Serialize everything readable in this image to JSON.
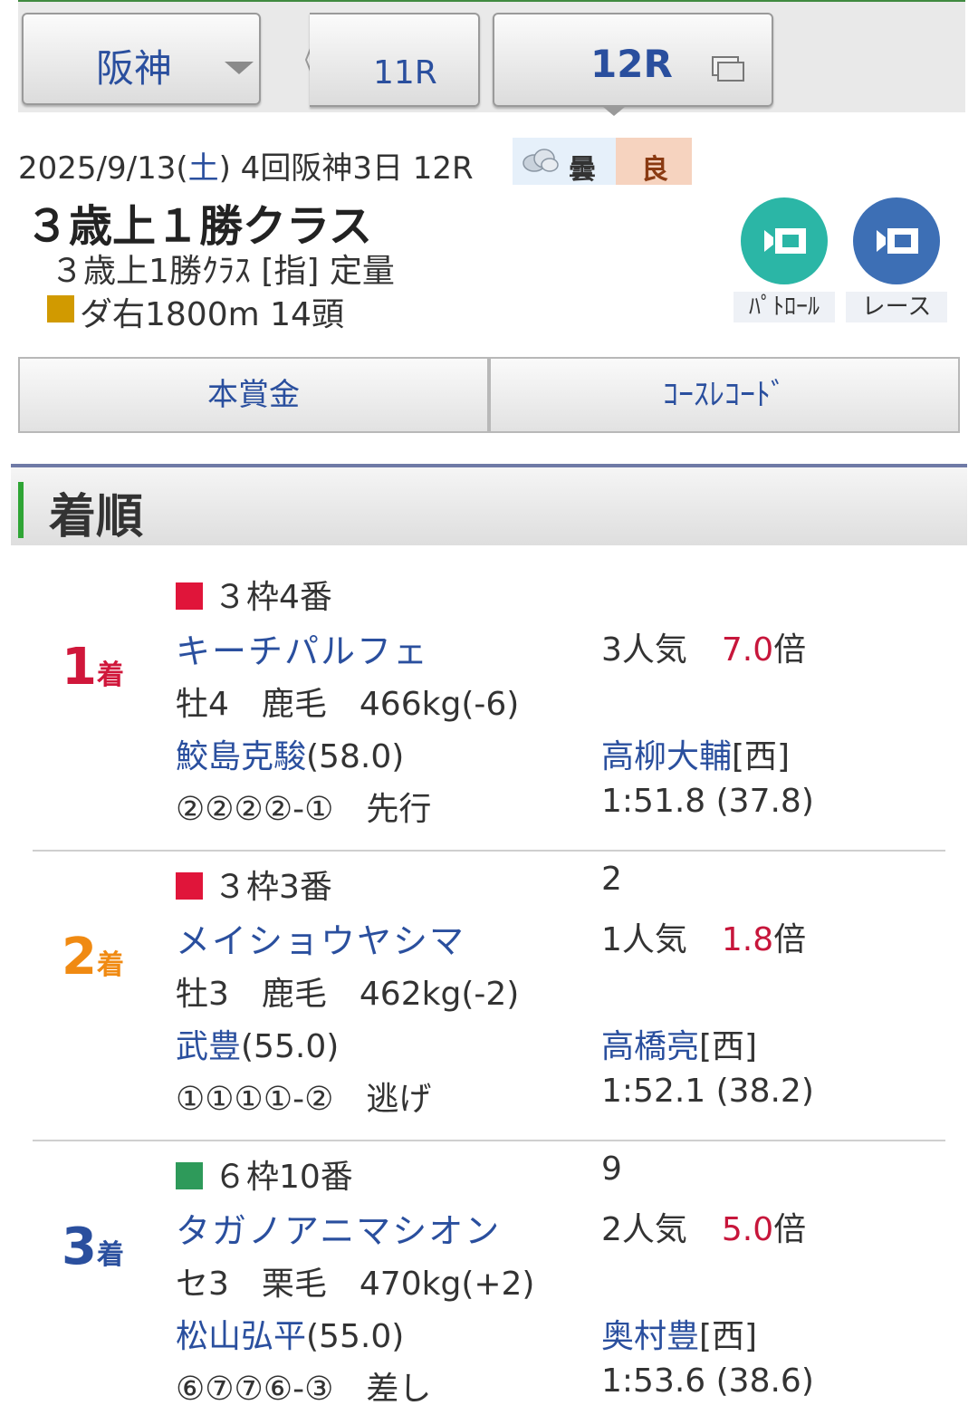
{
  "nav": {
    "venue": "阪神",
    "prev_race": "11R",
    "current_race": "12R"
  },
  "race": {
    "date": "2025/9/13(",
    "weekday": "土",
    "meeting": ") 4回阪神3日 12R",
    "weather": "曇",
    "track_condition": "良",
    "class_name": "３歳上１勝クラス",
    "conditions": "３歳上1勝ｸﾗｽ [指] 定量",
    "course": "ダ右1800m 14頭",
    "course_color": "#d19a00"
  },
  "videos": {
    "patrol_label": "ﾊﾟﾄﾛｰﾙ",
    "race_label": "レース"
  },
  "tabs": {
    "prize": "本賞金",
    "course_record": "ｺｰｽﾚｺｰﾄﾞ"
  },
  "section": {
    "title": "着順"
  },
  "results": [
    {
      "rank": "1",
      "rank_suffix": "着",
      "rank_color": "#d0173b",
      "gate_text": "３枠4番",
      "gate_color": "#e0153a",
      "margin": "",
      "horse": "キーチパルフェ",
      "popularity": "3人気",
      "odds": "7.0",
      "odds_unit": "倍",
      "info": "牡4　鹿毛　466kg(-6)",
      "jockey": "鮫島克駿",
      "jockey_weight": "(58.0)",
      "trainer": "高柳大輔",
      "trainer_region": "[西]",
      "corner": "②②②②-①　先行",
      "time": "1:51.8 (37.8)"
    },
    {
      "rank": "2",
      "rank_suffix": "着",
      "rank_color": "#f08a12",
      "gate_text": "３枠3番",
      "gate_color": "#e0153a",
      "margin": "2",
      "horse": "メイショウヤシマ",
      "popularity": "1人気",
      "odds": "1.8",
      "odds_unit": "倍",
      "info": "牡3　鹿毛　462kg(-2)",
      "jockey": "武豊",
      "jockey_weight": "(55.0)",
      "trainer": "高橋亮",
      "trainer_region": "[西]",
      "corner": "①①①①-②　逃げ",
      "time": "1:52.1 (38.2)"
    },
    {
      "rank": "3",
      "rank_suffix": "着",
      "rank_color": "#2a4f9e",
      "gate_text": "６枠10番",
      "gate_color": "#2e9a5a",
      "margin": "9",
      "horse": "タガノアニマシオン",
      "popularity": "2人気",
      "odds": "5.0",
      "odds_unit": "倍",
      "info": "セ3　栗毛　470kg(+2)",
      "jockey": "松山弘平",
      "jockey_weight": "(55.0)",
      "trainer": "奥村豊",
      "trainer_region": "[西]",
      "corner": "⑥⑦⑦⑥-③　差し",
      "time": "1:53.6 (38.6)"
    }
  ]
}
